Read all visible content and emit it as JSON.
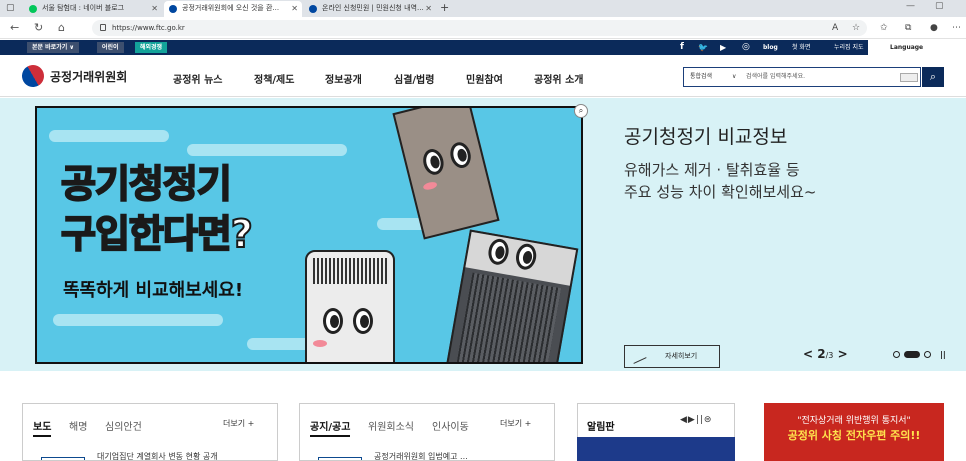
{
  "browser": {
    "tabs": [
      {
        "label": "서울 탐험대 : 네이버 블로그",
        "color": "#03c75a"
      },
      {
        "label": "공정거래위원회에 오신 것을 환...",
        "color": "#0047a0"
      },
      {
        "label": "온라인 신청민원 | 민원신청 내역...",
        "color": "#0047a0"
      }
    ],
    "url": "https://www.ftc.go.kr"
  },
  "utilbar": {
    "shortcut": "본문 바로가기 ∨",
    "kids": "어린이",
    "overseas": "해외경쟁",
    "social": [
      "f",
      "🐦",
      "▶",
      "◎",
      "blog"
    ],
    "home": "첫 화면",
    "sitemap": "누리집 지도",
    "language": "Language"
  },
  "header": {
    "logo_text": "공정거래위원회",
    "nav": [
      "공정위 뉴스",
      "정책/제도",
      "정보공개",
      "심결/법령",
      "민원참여",
      "공정위 소개"
    ],
    "search_scope": "통합검색",
    "search_placeholder": "검색어를 입력해주세요."
  },
  "banner": {
    "img_line1": "공기청정기",
    "img_line2": "구입한다면?",
    "img_line3": "똑똑하게 비교해보세요!",
    "title": "공기청정기 비교정보",
    "subtitle": "유해가스 제거 · 탈취효율 등\n주요 성능 차이 확인해보세요~",
    "more": "자세히보기",
    "page_current": "2",
    "page_total": "/3"
  },
  "boxes": {
    "news_tabs": [
      "보도",
      "해명",
      "심의안건"
    ],
    "news_more": "더보기 +",
    "news_item": "대기업집단 계열회사 변동 현황 공개",
    "notice_tabs": [
      "공지/공고",
      "위원회소식",
      "인사이동"
    ],
    "notice_more": "더보기 +",
    "notice_item": "공정거래위원회 입법예고 ...",
    "alert_title": "알림판",
    "alert_controls": "◀▶||⊜",
    "red_line1": "\"전자상거래 위반행위 통지서\"",
    "red_line2": "공정위 사칭 전자우편 주의!!"
  }
}
